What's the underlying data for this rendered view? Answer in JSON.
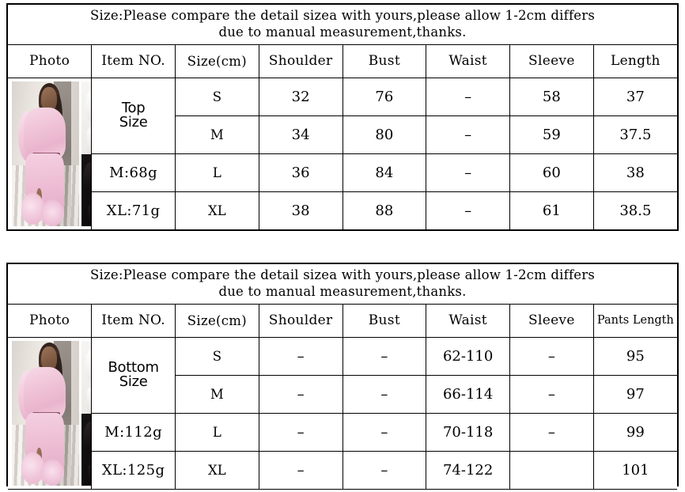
{
  "tables": [
    {
      "id": "top-size-chart",
      "note_line1": "Size:Please compare the detail sizea with yours,please allow 1-2cm differs",
      "note_line2": "due to manual measurement,thanks.",
      "headers": [
        "Photo",
        "Item NO.",
        "Size(cm)",
        "Shoulder",
        "Bust",
        "Waist",
        "Sleeve",
        "Length"
      ],
      "item_label_line1": "Top",
      "item_label_line2": "Size",
      "weight_m": "M:68g",
      "weight_xl": "XL:71g",
      "rows": [
        {
          "size": "S",
          "shoulder": "32",
          "bust": "76",
          "waist": "–",
          "sleeve": "58",
          "length": "37"
        },
        {
          "size": "M",
          "shoulder": "34",
          "bust": "80",
          "waist": "–",
          "sleeve": "59",
          "length": "37.5"
        },
        {
          "size": "L",
          "shoulder": "36",
          "bust": "84",
          "waist": "–",
          "sleeve": "60",
          "length": "38"
        },
        {
          "size": "XL",
          "shoulder": "38",
          "bust": "88",
          "waist": "–",
          "sleeve": "61",
          "length": "38.5"
        }
      ]
    },
    {
      "id": "bottom-size-chart",
      "note_line1": "Size:Please compare the detail sizea with yours,please allow 1-2cm differs",
      "note_line2": "due to manual measurement,thanks.",
      "headers": [
        "Photo",
        "Item NO.",
        "Size(cm)",
        "Shoulder",
        "Bust",
        "Waist",
        "Sleeve",
        "Pants Length"
      ],
      "item_label_line1": "Bottom",
      "item_label_line2": "Size",
      "weight_m": "M:112g",
      "weight_xl": "XL:125g",
      "rows": [
        {
          "size": "S",
          "shoulder": "–",
          "bust": "–",
          "waist": "62-110",
          "sleeve": "–",
          "length": "95"
        },
        {
          "size": "M",
          "shoulder": "–",
          "bust": "–",
          "waist": "66-114",
          "sleeve": "–",
          "length": "97"
        },
        {
          "size": "L",
          "shoulder": "–",
          "bust": "–",
          "waist": "70-118",
          "sleeve": "–",
          "length": "99"
        },
        {
          "size": "XL",
          "shoulder": "–",
          "bust": "–",
          "waist": "74-122",
          "sleeve": "",
          "length": "101"
        }
      ]
    }
  ],
  "photo": {
    "collage_name": "product-photo-collage",
    "main_photo_alt": "pink-mesh-two-piece-set",
    "white_photo_alt": "white-mesh-two-piece-set",
    "black_photo_alt": "black-mesh-two-piece-set",
    "colors": {
      "pink": "#efc3d8",
      "white": "#f2f1ef",
      "black": "#141012",
      "border": "#000000",
      "background": "#ffffff"
    }
  }
}
